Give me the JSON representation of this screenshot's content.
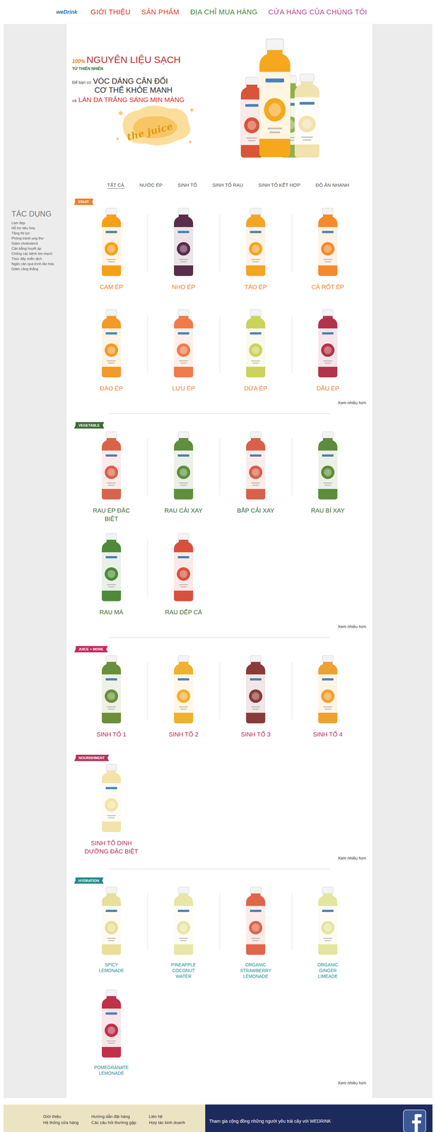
{
  "nav": {
    "logo": "weDrink",
    "items": [
      {
        "label": "GIỚI THIỆU",
        "color": "#d23a2e"
      },
      {
        "label": "SẢN PHẨM",
        "color": "#e2452f"
      },
      {
        "label": "ĐỊA CHỈ MUA HÀNG",
        "color": "#3e8a3e"
      },
      {
        "label": "CỬA HÀNG CỦA CHÚNG TÔI",
        "color": "#b54a9e"
      }
    ]
  },
  "sidebar": {
    "title": "TÁC DỤNG",
    "items": [
      "Làm đẹp",
      "Hỗ trợ tiêu hóa",
      "Tăng thị lực",
      "Phòng tránh ung thư",
      "Giảm cholesterol",
      "Cân bằng huyết áp",
      "Chống các bệnh tim mạch",
      "Thúc đẩy miễn dịch",
      "Ngăn cản quá trình lão hóa",
      "Giảm căng thẳng"
    ]
  },
  "hero": {
    "percent": "100%",
    "headline": "NGUYÊN LIỆU SẠCH",
    "subhead": "TỪ THIÊN NHIÊN",
    "intro": "Để bạn có",
    "benefit1": "VÓC DÁNG CÂN ĐỐI",
    "benefit2": "CƠ THỂ KHỎE MẠNH",
    "and": "và",
    "benefit3": "LÀN DA TRẮNG SÁNG MỊN MÀNG",
    "splash": "the juice",
    "bottles": [
      {
        "color": "#d9553a"
      },
      {
        "color": "#f5a81e"
      },
      {
        "color": "#8db04c"
      },
      {
        "color": "#f1e2b0"
      }
    ]
  },
  "tabs": [
    {
      "label": "TẤT CẢ",
      "selected": true
    },
    {
      "label": "NƯỚC ÉP",
      "selected": false
    },
    {
      "label": "SINH TỐ",
      "selected": false
    },
    {
      "label": "SINH TỐ RAU",
      "selected": false
    },
    {
      "label": "SINH TỐ KẾT HỢP",
      "selected": false
    },
    {
      "label": "ĐỒ ĂN NHANH",
      "selected": false
    }
  ],
  "sections": [
    {
      "tag": "FRUIT",
      "color": "#f0802a",
      "more": "Xem nhiều hơn",
      "products": [
        {
          "name": "CAM ÉP",
          "color": "#f6a01a"
        },
        {
          "name": "NHO ÉP",
          "color": "#5a2d4a"
        },
        {
          "name": "TÁO ÉP",
          "color": "#f4a528"
        },
        {
          "name": "CÀ RỐT ÉP",
          "color": "#f58a2c"
        },
        {
          "name": "ĐÀO ÉP",
          "color": "#f39a2a"
        },
        {
          "name": "LỰU ÉP",
          "color": "#f07a4a"
        },
        {
          "name": "DỨA ÉP",
          "color": "#cbd35a"
        },
        {
          "name": "DÂU ÉP",
          "color": "#b3344a"
        }
      ]
    },
    {
      "tag": "VEGETABLE",
      "color": "#3d6b34",
      "more": "Xem nhiều hơn",
      "products": [
        {
          "name": "RAU ÉP ĐẶC BIỆT",
          "color": "#d9634a"
        },
        {
          "name": "RAU CẢI XAY",
          "color": "#5f8f3e"
        },
        {
          "name": "BẮP CẢI XAY",
          "color": "#d9604a"
        },
        {
          "name": "RAU BÍ XAY",
          "color": "#5d8c3c"
        },
        {
          "name": "RAU MÁ",
          "color": "#4f8a3a"
        },
        {
          "name": "RAU DẾP CÁ",
          "color": "#d9503f"
        }
      ]
    },
    {
      "tag": "JUICE + MORE",
      "color": "#c42a5a",
      "products": [
        {
          "name": "SINH TỐ 1",
          "color": "#6b8f3b"
        },
        {
          "name": "SINH TỐ 2",
          "color": "#f0b030"
        },
        {
          "name": "SINH TỐ 3",
          "color": "#8a3a3a"
        },
        {
          "name": "SINH TỐ 4",
          "color": "#f0a030"
        }
      ]
    },
    {
      "tag": "NOURISHMENT",
      "color": "#b8305a",
      "more": "Xem nhiều hơn",
      "products": [
        {
          "name": "SINH TỐ DINH DƯỠNG ĐẶC BIỆT",
          "color": "#f3e3a8"
        }
      ]
    },
    {
      "tag": "HYDRATION",
      "color": "#1f8a90",
      "more": "Xem nhiều hơn",
      "products": [
        {
          "name": "SPICY LEMONADE",
          "color": "#e7df9a"
        },
        {
          "name": "PINEAPPLE COCONUT WATER",
          "color": "#e8e6a8"
        },
        {
          "name": "ORGANIC STRAWBERRY LEMONADE",
          "color": "#e0654a"
        },
        {
          "name": "ORGANIC GINGER LIMEADE",
          "color": "#e3e6a0"
        },
        {
          "name": "POMEGRANATE LEMONADE",
          "color": "#c0304a"
        }
      ]
    }
  ],
  "footer": {
    "columns": [
      {
        "links": [
          "Giới thiệu",
          "Hệ thống cửa hàng"
        ]
      },
      {
        "links": [
          "Hướng dẫn đặt hàng",
          "Các câu hỏi thường gặp"
        ]
      },
      {
        "links": [
          "Liên hệ",
          "Hợp tác kinh doanh"
        ]
      }
    ],
    "community": "Tham gia cộng đồng những người yêu trái cây với WEDRINK"
  }
}
